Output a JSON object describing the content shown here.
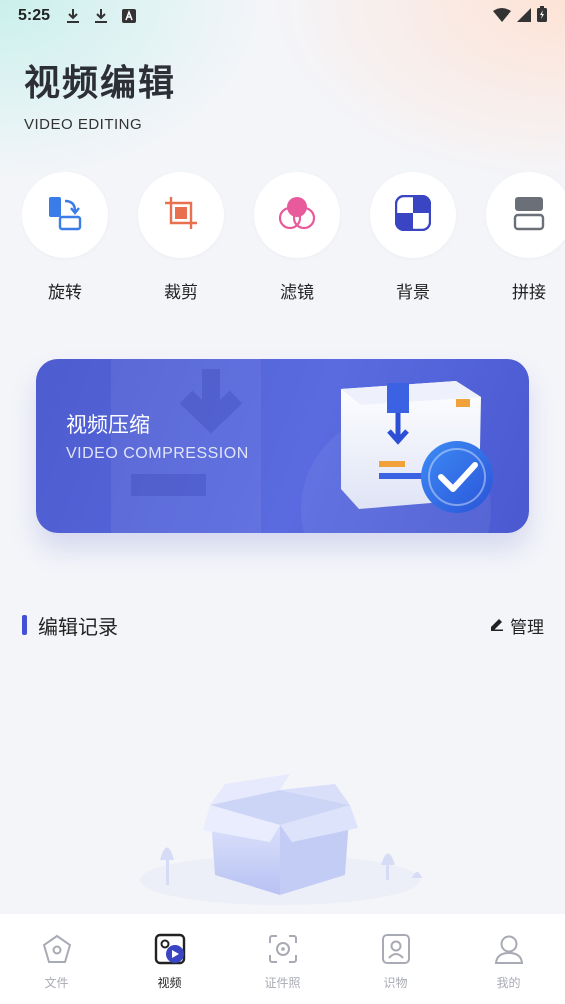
{
  "status_bar": {
    "time": "5:25",
    "icons": [
      "download-icon",
      "download-icon",
      "app-notification-icon",
      "wifi-icon",
      "signal-icon",
      "battery-charging-icon"
    ]
  },
  "header": {
    "title": "视频编辑",
    "subtitle": "VIDEO EDITING"
  },
  "tools": [
    {
      "label": "旋转",
      "icon": "rotate-icon",
      "color": "#3b7de8"
    },
    {
      "label": "裁剪",
      "icon": "crop-icon",
      "color": "#e8704f"
    },
    {
      "label": "滤镜",
      "icon": "filter-icon",
      "color": "#e85a9c"
    },
    {
      "label": "背景",
      "icon": "background-icon",
      "color": "#3a45c4"
    },
    {
      "label": "拼接",
      "icon": "splice-icon",
      "color": "#6b7078"
    }
  ],
  "banner": {
    "title": "视频压缩",
    "subtitle": "VIDEO COMPRESSION"
  },
  "records": {
    "title": "编辑记录",
    "manage_label": "管理"
  },
  "bottom_nav": {
    "items": [
      {
        "label": "文件",
        "icon": "file-icon",
        "active": false
      },
      {
        "label": "视频",
        "icon": "video-icon",
        "active": true
      },
      {
        "label": "证件照",
        "icon": "id-photo-icon",
        "active": false
      },
      {
        "label": "识物",
        "icon": "recognize-icon",
        "active": false
      },
      {
        "label": "我的",
        "icon": "profile-icon",
        "active": false
      }
    ]
  },
  "colors": {
    "accent": "#4150d6",
    "banner": "#5564d8"
  }
}
